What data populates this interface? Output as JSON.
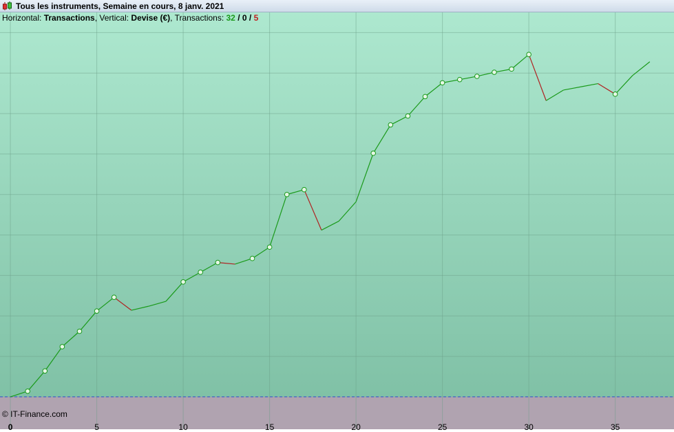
{
  "window": {
    "title": "Tous les instruments, Semaine en cours, 8 janv. 2021"
  },
  "info": {
    "h_label": "Horizontal: ",
    "h_value": "Transactions",
    "v_label": ", Vertical: ",
    "v_value": "Devise (€)",
    "t_label": ", Transactions: ",
    "wins": "32",
    "sep1": " / ",
    "neutral": "0",
    "sep2": " / ",
    "losses": "5"
  },
  "footer": {
    "copyright": "© IT-Finance.com"
  },
  "colors": {
    "win_line": "#1a9a1a",
    "loss_line": "#b02020",
    "baseline": "#3050d0",
    "bg_top": "#ade8cf",
    "bg_bottom": "#80c1a6",
    "below_zero": "#b0a3b0"
  },
  "chart_data": {
    "type": "line",
    "title": "",
    "xlabel": "Transactions",
    "ylabel": "Devise (€)",
    "x_ticks": [
      "0",
      "5",
      "10",
      "15",
      "20",
      "25",
      "30",
      "35"
    ],
    "xlim": [
      -0.6,
      38.4
    ],
    "ylim": [
      -4.0,
      47.5
    ],
    "grid": true,
    "baseline_value": 0,
    "x": [
      0,
      1,
      2,
      3,
      4,
      5,
      6,
      7,
      8,
      9,
      10,
      11,
      12,
      13,
      14,
      15,
      16,
      17,
      18,
      19,
      20,
      21,
      22,
      23,
      24,
      25,
      26,
      27,
      28,
      29,
      30,
      31,
      32,
      33,
      34,
      35,
      36,
      37
    ],
    "equity": [
      0,
      0.7,
      3.2,
      6.2,
      8.1,
      10.6,
      12.3,
      10.7,
      11.2,
      11.8,
      14.2,
      15.4,
      16.6,
      16.4,
      17.1,
      18.5,
      25.0,
      25.6,
      20.6,
      21.7,
      24.1,
      30.1,
      33.6,
      34.7,
      37.1,
      38.8,
      39.2,
      39.6,
      40.1,
      40.5,
      42.3,
      36.6,
      37.9,
      38.3,
      38.7,
      37.4,
      39.7,
      41.4
    ],
    "markers": [
      false,
      true,
      true,
      true,
      true,
      true,
      true,
      false,
      false,
      false,
      true,
      true,
      true,
      false,
      true,
      true,
      true,
      true,
      false,
      false,
      false,
      true,
      true,
      true,
      true,
      true,
      true,
      true,
      true,
      true,
      true,
      false,
      false,
      false,
      false,
      true,
      false,
      false
    ]
  }
}
